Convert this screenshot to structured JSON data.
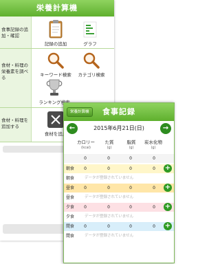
{
  "back_screen": {
    "title": "栄養計算機",
    "sections": [
      {
        "label": "食事記録の追加・確認",
        "tiles": [
          {
            "label": "記録の追加",
            "icon": "clipboard-icon"
          },
          {
            "label": "グラフ",
            "icon": "graph-icon"
          }
        ]
      },
      {
        "label": "食材・料理の栄養素を調べる",
        "tiles": [
          {
            "label": "キーワード検索",
            "icon": "magnifier-icon"
          },
          {
            "label": "カテゴリ検索",
            "icon": "magnifier-icon"
          },
          {
            "label": "ランキング検索",
            "icon": "trophy-icon"
          }
        ]
      },
      {
        "label": "食材・料理を追加する",
        "tiles": [
          {
            "label": "食材を追加",
            "icon": "knife-fork-icon"
          }
        ]
      }
    ]
  },
  "front_screen": {
    "back_button": "栄養計算機",
    "title": "食事記録",
    "date": "2015年6月21日(日)",
    "columns": [
      {
        "name": "カロリー",
        "unit": "(kcal)"
      },
      {
        "name": "た質",
        "unit": "(g)"
      },
      {
        "name": "脂質",
        "unit": "(g)"
      },
      {
        "name": "炭水化物",
        "unit": "(g)"
      }
    ],
    "no_data_text": "データが登録されていません",
    "meals": [
      {
        "name": "朝食",
        "values": [
          "0",
          "0",
          "0",
          "0"
        ],
        "color": "#fff6c9"
      },
      {
        "name": "昼食",
        "values": [
          "0",
          "0",
          "0",
          "0"
        ],
        "color": "#ffe6a8"
      },
      {
        "name": "夕食",
        "values": [
          "0",
          "0",
          "0",
          "0"
        ],
        "color": "#fde0e4"
      },
      {
        "name": "間食",
        "values": [
          "0",
          "0",
          "0",
          "0"
        ],
        "color": "#d8eefa"
      }
    ],
    "total": {
      "values": [
        "0",
        "0",
        "0",
        "0"
      ]
    }
  },
  "colors": {
    "header_green": "#6cbf3a",
    "arrow_green": "#2e8c1f",
    "plus_green": "#2e9a22"
  }
}
